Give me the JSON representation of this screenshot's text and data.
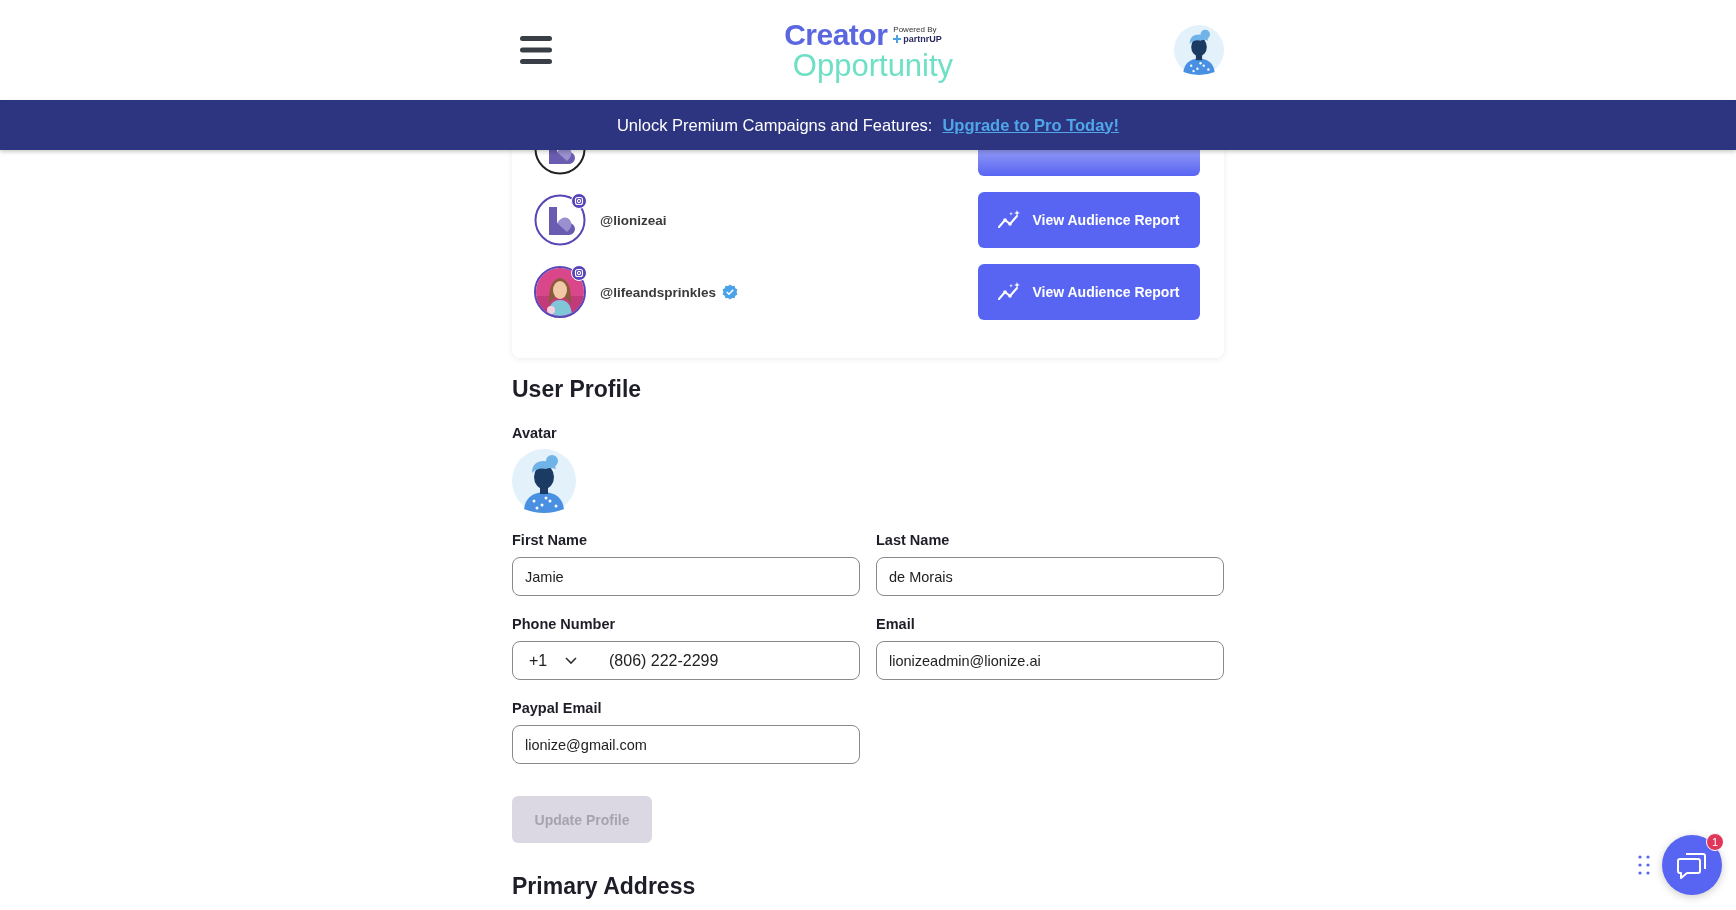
{
  "header": {
    "logo": {
      "word_1": "Creator",
      "word_2": "Opportunity",
      "powered_by": "Powered By",
      "partner": "partnrUP"
    }
  },
  "banner": {
    "text": "Unlock Premium Campaigns and Features:",
    "link": "Upgrade to Pro Today!"
  },
  "accounts": [
    {
      "kind": "partial",
      "avatar": {
        "kind": "logo"
      }
    },
    {
      "kind": "full",
      "avatar": {
        "kind": "logo"
      },
      "handle": "@lionizeai",
      "instagram": true,
      "verified": false,
      "button": "View Audience Report"
    },
    {
      "kind": "full",
      "handle": "@lifeandsprinkles",
      "instagram": true,
      "verified": true,
      "button": "View Audience Report"
    }
  ],
  "profile": {
    "title": "User Profile",
    "avatar_label": "Avatar",
    "fields": [
      {
        "kind": "text",
        "label": "First Name",
        "value": "Jamie"
      },
      {
        "kind": "text",
        "label": "Last Name",
        "value": "de Morais"
      },
      {
        "kind": "phone",
        "label": "Phone Number",
        "country_code": "+1",
        "value": "(806) 222-2299"
      },
      {
        "kind": "text",
        "label": "Email",
        "value": "lionizeadmin@lionize.ai"
      },
      {
        "kind": "text",
        "label": "Paypal Email",
        "value": "lionize@gmail.com"
      }
    ],
    "submit": {
      "label": "Update Profile",
      "disabled": true
    }
  },
  "next_section": {
    "title": "Primary Address"
  },
  "chat": {
    "badge": "1"
  }
}
